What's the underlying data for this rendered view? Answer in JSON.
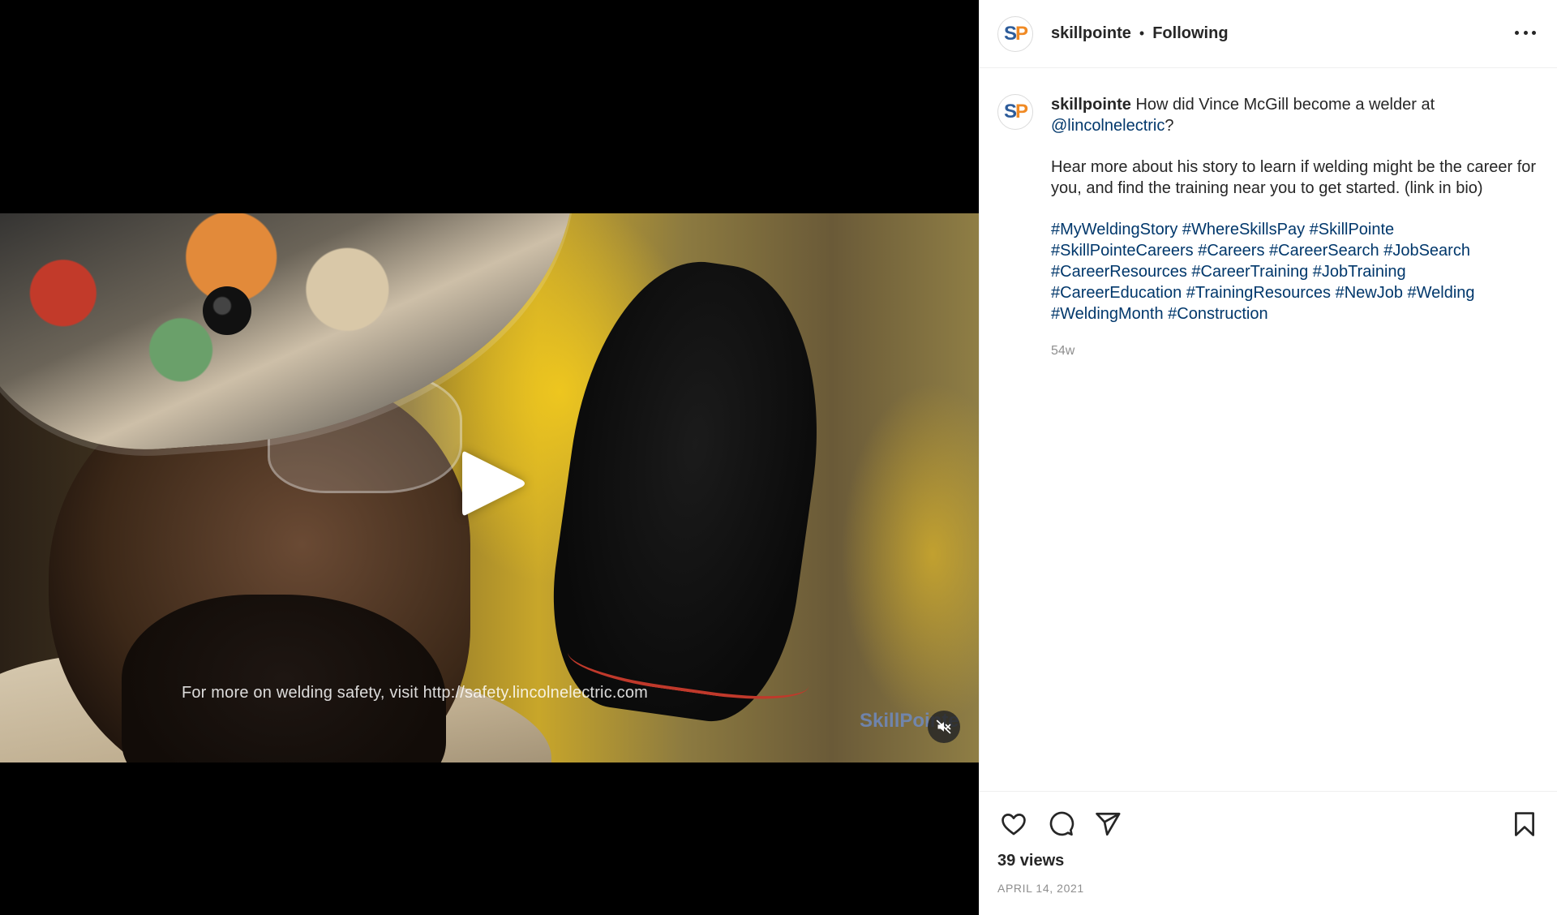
{
  "post": {
    "video": {
      "subtitle": "For more on welding safety, visit http://safety.lincolnelectric.com",
      "watermark": "SkillPointe"
    },
    "header": {
      "avatar_initials": [
        "S",
        "P"
      ],
      "username": "skillpointe",
      "separator": "•",
      "follow_status": "Following"
    },
    "caption": {
      "username": "skillpointe",
      "line1_prefix": " How did Vince McGill become a welder at ",
      "mention": "@lincolnelectric",
      "line1_suffix": "?",
      "paragraph2": "Hear more about his story to learn if welding might be the career for you, and find the training near you to get started. (link in bio)",
      "hashtags": [
        "#MyWeldingStory",
        "#WhereSkillsPay",
        "#SkillPointe",
        "#SkillPointeCareers",
        "#Careers",
        "#CareerSearch",
        "#JobSearch",
        "#CareerResources",
        "#CareerTraining",
        "#JobTraining",
        "#CareerEducation",
        "#TrainingResources",
        "#NewJob",
        "#Welding",
        "#WeldingMonth",
        "#Construction"
      ],
      "age": "54w"
    },
    "stats": {
      "views": "39 views",
      "date": "APRIL 14, 2021"
    },
    "icons": {
      "play": "play-icon",
      "mute": "muted-speaker-icon",
      "more": "more-options-icon",
      "like": "heart-icon",
      "comment": "comment-bubble-icon",
      "share": "paper-plane-icon",
      "save": "bookmark-icon"
    },
    "colors": {
      "link": "#00376b",
      "text": "#262626",
      "muted": "#8e8e8e",
      "avatar_s": "#2d5c9a",
      "avatar_p": "#f08a24"
    }
  }
}
